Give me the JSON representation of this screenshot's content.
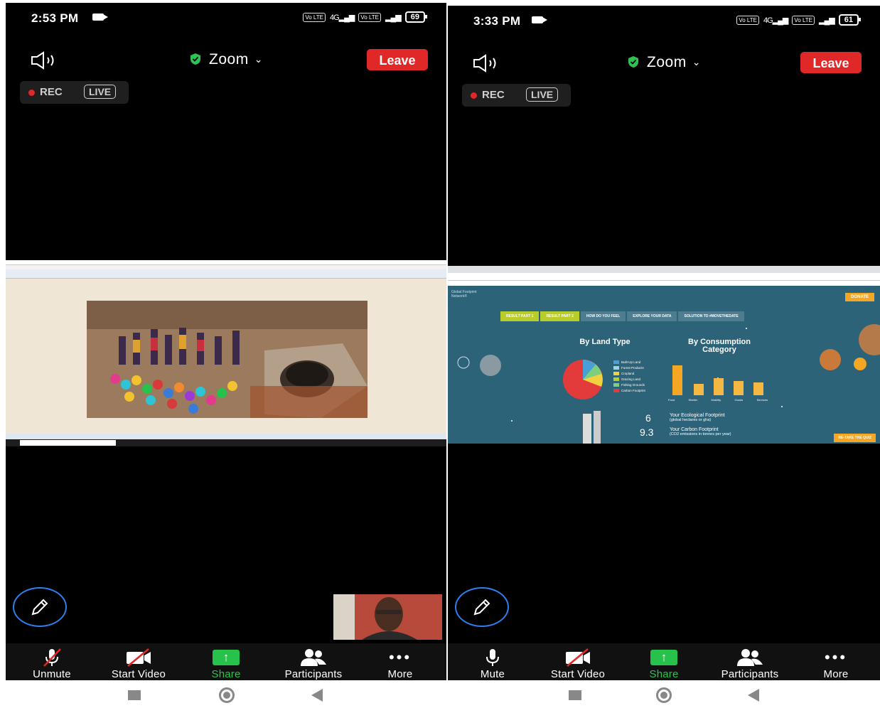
{
  "left": {
    "status": {
      "time": "2:53 PM",
      "volte1": "Vo LTE",
      "net": "4G",
      "volte2": "Vo LTE",
      "battery": "69"
    },
    "header": {
      "title": "Zoom",
      "leave_label": "Leave"
    },
    "recording": {
      "rec_label": "REC",
      "live_label": "LIVE"
    },
    "toolbar": {
      "mic_label": "Unmute",
      "video_label": "Start Video",
      "share_label": "Share",
      "participants_label": "Participants",
      "more_label": "More"
    }
  },
  "right": {
    "status": {
      "time": "3:33 PM",
      "volte1": "Vo LTE",
      "net": "4G",
      "volte2": "Vo LTE",
      "battery": "61"
    },
    "header": {
      "title": "Zoom",
      "leave_label": "Leave"
    },
    "recording": {
      "rec_label": "REC",
      "live_label": "LIVE"
    },
    "shared_screen": {
      "donate": "DONATE",
      "tabs": [
        "RESULT PART 1",
        "RESULT PART 2",
        "HOW DO YOU FEEL",
        "EXPLORE YOUR DATA",
        "SOLUTION TO #MOVETHEDATE"
      ],
      "land_heading": "By Land Type",
      "consumption_heading": "By Consumption Category",
      "legend": [
        "Built-Up Land",
        "Forest Products",
        "Cropland",
        "Grazing Land",
        "Fishing Grounds",
        "Carbon Footprint"
      ],
      "bar_labels": [
        "Food",
        "Shelter",
        "Mobility",
        "Goods",
        "Services"
      ],
      "eco_value": "6",
      "eco_label": "Your Ecological Footprint",
      "eco_sub": "(global hectares or gha)",
      "carbon_value": "9.3",
      "carbon_label": "Your Carbon Footprint",
      "carbon_sub": "(CO2 emissions in tonnes per year)",
      "quiz": "RE-TAKE THE QUIZ"
    },
    "toolbar": {
      "mic_label": "Mute",
      "video_label": "Start Video",
      "share_label": "Share",
      "participants_label": "Participants",
      "more_label": "More"
    }
  },
  "colors": {
    "leave": "#e02828",
    "share_green": "#27c24c",
    "pencil_ring": "#2f7ff0",
    "rec_dot": "#e02828"
  }
}
